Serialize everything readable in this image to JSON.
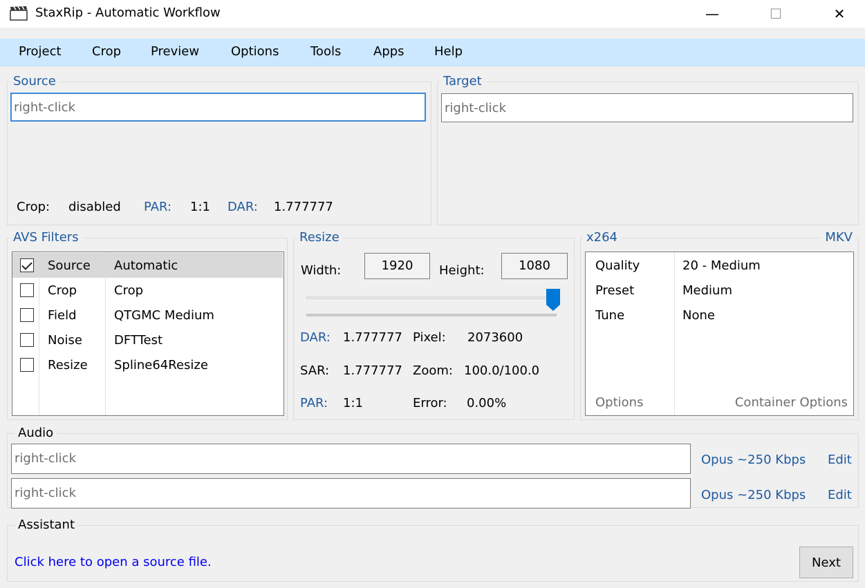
{
  "window": {
    "title": "StaxRip - Automatic Workflow",
    "minimize": "—",
    "maximize": "☐",
    "close": "✕"
  },
  "menu": [
    "Project",
    "Crop",
    "Preview",
    "Options",
    "Tools",
    "Apps",
    "Help"
  ],
  "source": {
    "label": "Source",
    "placeholder": "right-click",
    "crop_label": "Crop:",
    "crop_value": "disabled",
    "par_label": "PAR:",
    "par_value": "1:1",
    "dar_label": "DAR:",
    "dar_value": "1.777777"
  },
  "target": {
    "label": "Target",
    "placeholder": "right-click"
  },
  "filters": {
    "label": "AVS Filters",
    "items": [
      {
        "checked": true,
        "category": "Source",
        "name": "Automatic"
      },
      {
        "checked": false,
        "category": "Crop",
        "name": "Crop"
      },
      {
        "checked": false,
        "category": "Field",
        "name": "QTGMC Medium"
      },
      {
        "checked": false,
        "category": "Noise",
        "name": "DFTTest"
      },
      {
        "checked": false,
        "category": "Resize",
        "name": "Spline64Resize"
      }
    ]
  },
  "resize": {
    "label": "Resize",
    "width_label": "Width:",
    "width_value": "1920",
    "height_label": "Height:",
    "height_value": "1080",
    "slider_fraction": 1.0,
    "dar_label": "DAR:",
    "dar_value": "1.777777",
    "pixel_label": "Pixel:",
    "pixel_value": "2073600",
    "sar_label": "SAR:",
    "sar_value": "1.777777",
    "zoom_label": "Zoom:",
    "zoom_value": "100.0/100.0",
    "par_label": "PAR:",
    "par_value": "1:1",
    "error_label": "Error:",
    "error_value": "0.00%"
  },
  "encoder": {
    "label": "x264",
    "container": "MKV",
    "rows": [
      {
        "key": "Quality",
        "value": "20 - Medium"
      },
      {
        "key": "Preset",
        "value": "Medium"
      },
      {
        "key": "Tune",
        "value": "None"
      }
    ],
    "options_label": "Options",
    "container_options_label": "Container Options"
  },
  "audio": {
    "label": "Audio",
    "tracks": [
      {
        "placeholder": "right-click",
        "codec": "Opus ~250 Kbps",
        "edit": "Edit"
      },
      {
        "placeholder": "right-click",
        "codec": "Opus ~250 Kbps",
        "edit": "Edit"
      }
    ]
  },
  "assistant": {
    "label": "Assistant",
    "message": "Click here to open a source file.",
    "next": "Next"
  },
  "colors": {
    "menubar": "#cce8ff",
    "link": "#0000ee",
    "label_blue": "#1e5aa0",
    "focus": "#3c8ad8",
    "slider_thumb": "#0078d7"
  }
}
